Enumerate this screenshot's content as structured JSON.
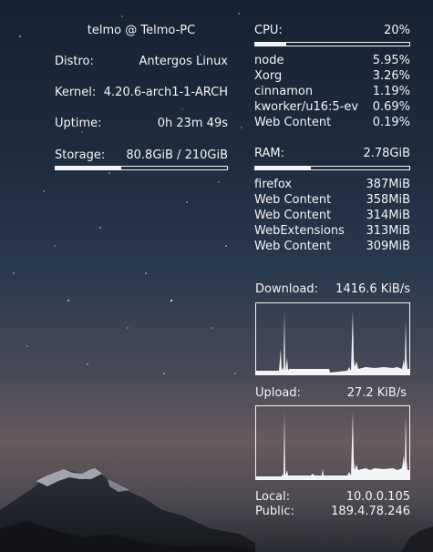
{
  "system": {
    "header": "telmo @ Telmo-PC",
    "distro_label": "Distro:",
    "distro_value": "Antergos Linux",
    "kernel_label": "Kernel:",
    "kernel_value": "4.20.6-arch1-1-ARCH",
    "uptime_label": "Uptime:",
    "uptime_value": "0h 23m 49s",
    "storage_label": "Storage:",
    "storage_value": "80.8GiB / 210GiB",
    "storage_fraction": 0.385
  },
  "cpu": {
    "label": "CPU:",
    "value": "20%",
    "fraction": 0.2,
    "processes": [
      {
        "name": "node",
        "value": "5.95%"
      },
      {
        "name": "Xorg",
        "value": "3.26%"
      },
      {
        "name": "cinnamon",
        "value": "1.19%"
      },
      {
        "name": "kworker/u16:5-ev",
        "value": "0.69%"
      },
      {
        "name": "Web Content",
        "value": "0.19%"
      }
    ]
  },
  "ram": {
    "label": "RAM:",
    "value": "2.78GiB",
    "fraction": 0.36,
    "processes": [
      {
        "name": "firefox",
        "value": "387MiB"
      },
      {
        "name": "Web Content",
        "value": "358MiB"
      },
      {
        "name": "Web Content",
        "value": "314MiB"
      },
      {
        "name": "WebExtensions",
        "value": "313MiB"
      },
      {
        "name": "Web Content",
        "value": "309MiB"
      }
    ]
  },
  "network": {
    "download_label": "Download:",
    "download_value": "1416.6 KiB/s",
    "upload_label": "Upload:",
    "upload_value": "27.2 KiB/s",
    "local_label": "Local:",
    "local_value": "10.0.0.105",
    "public_label": "Public:",
    "public_value": "189.4.78.246"
  },
  "colors": {
    "text": "#f2f4f6",
    "sky_top": "#152232",
    "sky_glow": "#665a5e"
  }
}
